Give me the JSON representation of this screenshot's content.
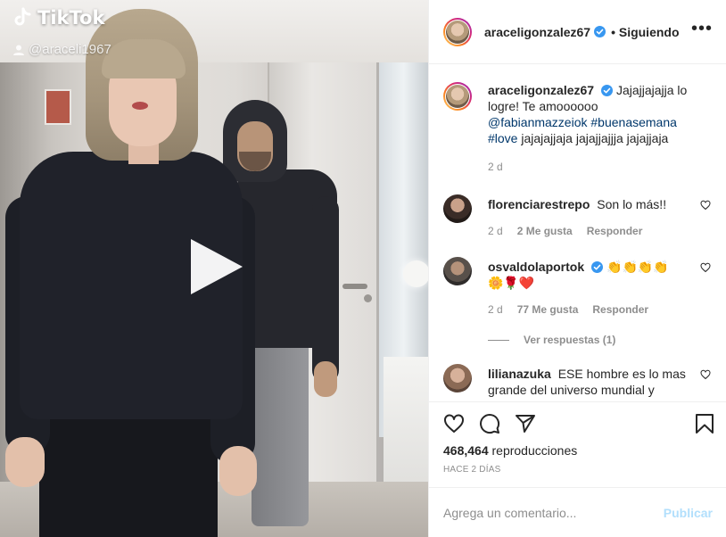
{
  "video": {
    "watermark_brand": "TikTok",
    "watermark_user": "@araceli1967"
  },
  "header": {
    "username": "araceligonzalez67",
    "follow_state": "• Siguiendo",
    "more_icon": "more-horizontal-icon"
  },
  "caption": {
    "username": "araceligonzalez67",
    "text_before": "Jajajjajajja lo logre! Te amoooooo",
    "mention": "@fabianmazzeiok",
    "hashtag1": "#buenasemana",
    "hashtag2": "#love",
    "text_after": "jajajajjaja jajajjajjja jajajjaja",
    "age": "2 d"
  },
  "comments": [
    {
      "username": "florenciarestrepo",
      "text": "Son lo más!!",
      "age": "2 d",
      "likes": "2 Me gusta",
      "reply": "Responder"
    },
    {
      "username": "osvaldolaportok",
      "text": "👏👏👏👏 🌼🌹❤️",
      "age": "2 d",
      "likes": "77 Me gusta",
      "reply": "Responder",
      "view_replies": "Ver respuestas (1)"
    },
    {
      "username": "lilianazuka",
      "text": "ESE hombre es lo mas grande del universo mundial y"
    }
  ],
  "actions": {
    "views_count": "468,464",
    "views_label": "reproducciones",
    "time_ago": "HACE 2 DÍAS"
  },
  "add_comment": {
    "placeholder": "Agrega un comentario...",
    "publish_label": "Publicar"
  },
  "colors": {
    "verified": "#3897f0",
    "link": "#00376b",
    "muted": "#8e8e8e",
    "publish_disabled": "#b2dffc"
  }
}
